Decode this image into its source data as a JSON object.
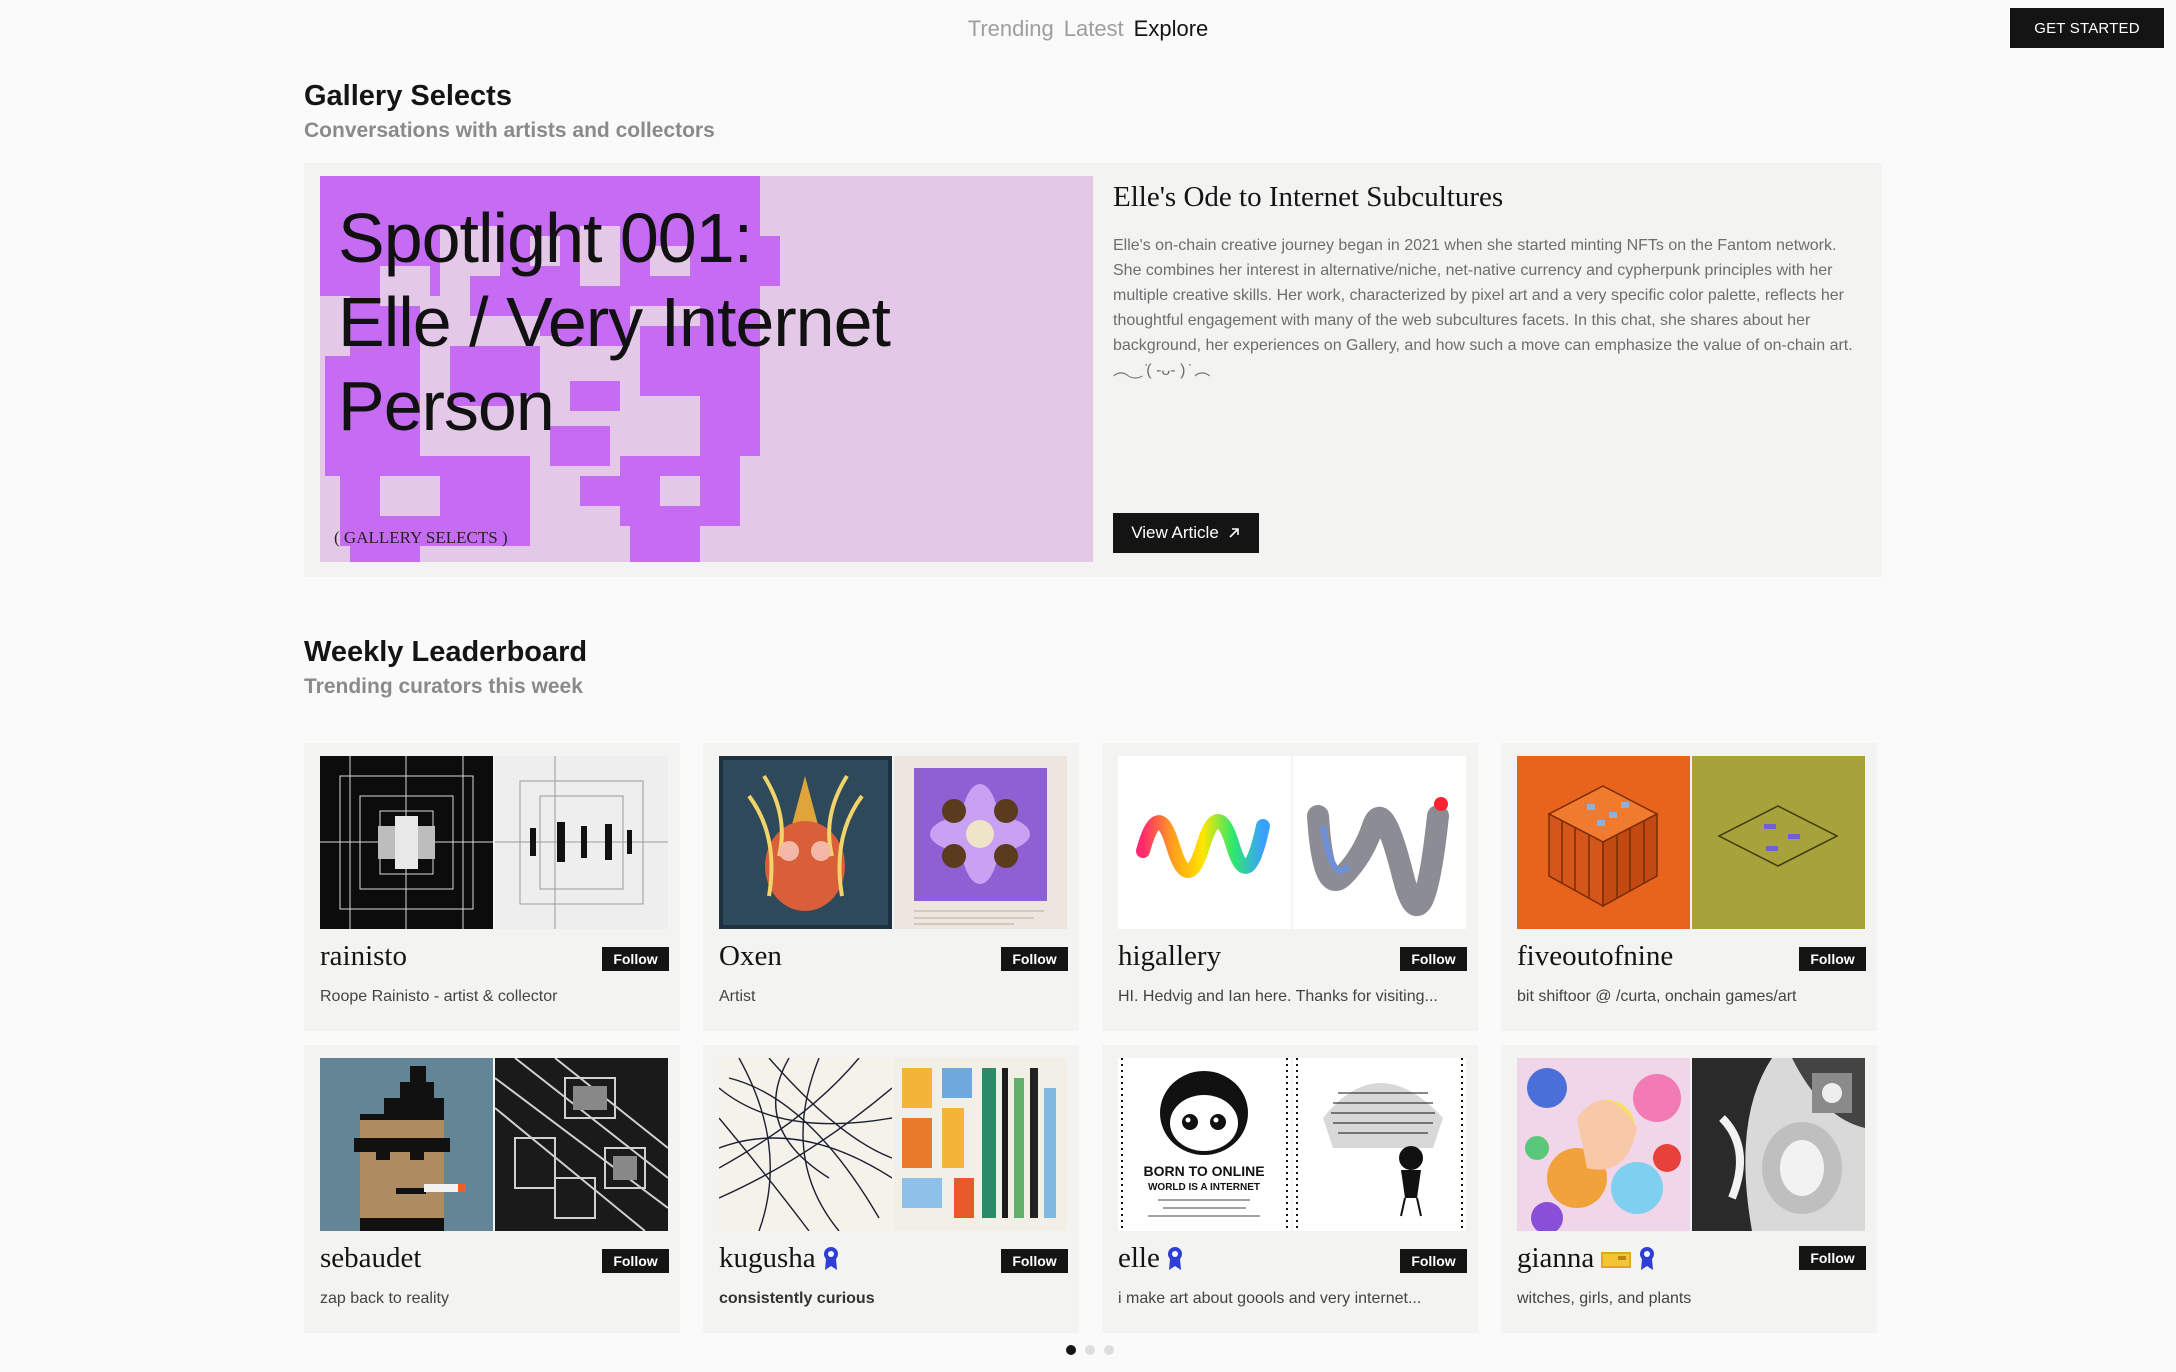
{
  "nav": {
    "tabs": [
      "Trending",
      "Latest",
      "Explore"
    ],
    "active_tab": "Explore",
    "cta_label": "GET STARTED"
  },
  "gallery_selects": {
    "title": "Gallery Selects",
    "subtitle": "Conversations with artists and collectors",
    "feature": {
      "art_title_lines": [
        "Spotlight 001:",
        "Elle / Very Internet",
        "Person"
      ],
      "art_tag": "( GALLERY SELECTS )",
      "headline": "Elle's Ode to Internet Subcultures",
      "description": "Elle's on-chain creative journey began in 2021 when she started minting NFTs on the Fantom network. She combines her interest in alternative/niche, net-native currency and cypherpunk principles with her multiple creative skills. Her work, characterized by pixel art and a very specific color palette, reflects her thoughtful engagement with many of the web subcultures facets. In this chat, she shares about her background, her experiences on Gallery, and how such a move can emphasize the value of on-chain art. ︵‿ ̇( -ᴗ- ) ̇ ︵",
      "button_label": "View Article",
      "accent_color": "#c66cf3"
    }
  },
  "leaderboard": {
    "title": "Weekly Leaderboard",
    "subtitle": "Trending curators this week",
    "follow_label": "Follow",
    "curators": [
      {
        "name": "rainisto",
        "bio": "Roope Rainisto - artist & collector",
        "badges": []
      },
      {
        "name": "Oxen",
        "bio": "Artist",
        "badges": []
      },
      {
        "name": "higallery",
        "bio": "HI. Hedvig and Ian here. Thanks for visiting...",
        "badges": []
      },
      {
        "name": "fiveoutofnine",
        "bio": "bit shiftoor @ /curta, onchain games/art",
        "badges": []
      },
      {
        "name": "sebaudet",
        "bio": "zap back to reality",
        "badges": []
      },
      {
        "name": "kugusha",
        "bio": "consistently curious",
        "badges": [
          "ribbon-badge-icon"
        ]
      },
      {
        "name": "elle",
        "bio": "i make art about goools and very internet...",
        "badges": [
          "ribbon-badge-icon"
        ]
      },
      {
        "name": "gianna",
        "bio": "witches, girls, and plants",
        "badges": [
          "gold-card-badge-icon",
          "ribbon-badge-icon"
        ]
      }
    ],
    "carousel_pages": 3,
    "carousel_active": 1
  },
  "colors": {
    "ink": "#141414",
    "muted": "#8a8a8a",
    "badge_blue": "#2d3fd6",
    "card_bg": "#f3f3f2"
  },
  "icons": {
    "view_article_arrow": "arrow-up-right-icon"
  }
}
